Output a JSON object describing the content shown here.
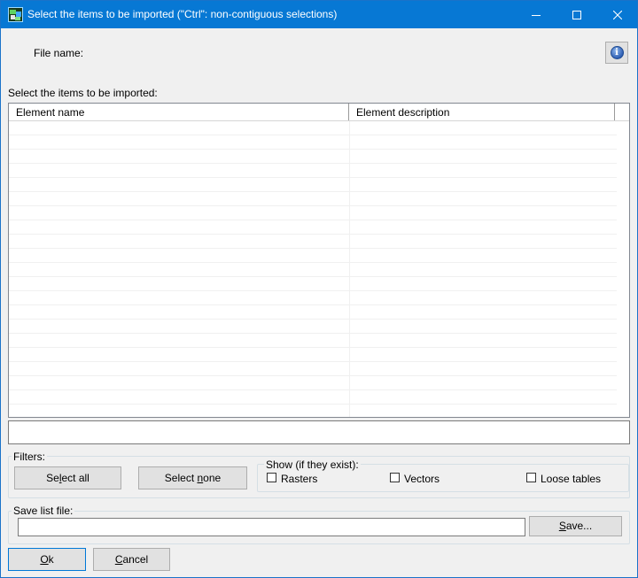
{
  "window": {
    "title": "Select the items to be imported (\"Ctrl\": non-contiguous selections)",
    "icon": "map-app-icon",
    "controls": [
      "minimize-icon",
      "maximize-icon",
      "close-icon"
    ]
  },
  "file": {
    "label": "File name:",
    "value": ""
  },
  "info_button": {
    "icon": "info-icon"
  },
  "list": {
    "label": "Select the items to be imported:",
    "columns": [
      "Element name",
      "Element description"
    ],
    "rows": []
  },
  "status_text": "",
  "filters": {
    "title": "Filters:",
    "select_all": {
      "pre": "Se",
      "key": "l",
      "post": "ect all"
    },
    "select_none": {
      "pre": "Select ",
      "key": "n",
      "post": "one"
    }
  },
  "show": {
    "title": "Show (if they exist):",
    "options": [
      {
        "label": "Rasters",
        "checked": false
      },
      {
        "label": "Vectors",
        "checked": false
      },
      {
        "label": "Loose tables",
        "checked": false
      }
    ]
  },
  "save_list": {
    "title": "Save list file:",
    "value": "",
    "save": {
      "key": "S",
      "post": "ave..."
    }
  },
  "footer": {
    "ok": {
      "key": "O",
      "post": "k"
    },
    "cancel": {
      "key": "C",
      "post": "ancel"
    }
  }
}
